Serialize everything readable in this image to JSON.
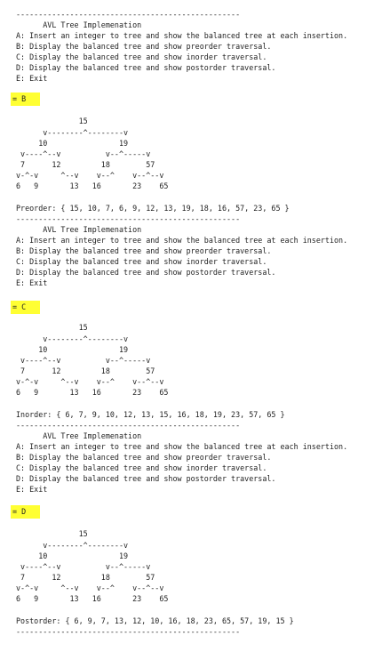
{
  "console": {
    "blocks": [
      {
        "sep_top": "--------------------------------------------------",
        "menu_title": "      AVL Tree Implemenation",
        "menu": [
          "A: Insert an integer to tree and show the balanced tree at each insertion.",
          "B: Display the balanced tree and show preorder traversal.",
          "C: Display the balanced tree and show inorder traversal.",
          "D: Display the balanced tree and show postorder traversal.",
          "E: Exit"
        ],
        "prompt": "= B",
        "tree": [
          "              15",
          "      v--------^--------v",
          "     10                19",
          " v----^--v          v--^-----v",
          " 7      12         18        57",
          "v-^-v     ^--v    v--^    v--^--v",
          "6   9       13   16       23    65"
        ],
        "result": "Preorder: { 15, 10, 7, 6, 9, 12, 13, 19, 18, 16, 57, 23, 65 }"
      },
      {
        "sep_top": "--------------------------------------------------",
        "menu_title": "      AVL Tree Implemenation",
        "menu": [
          "A: Insert an integer to tree and show the balanced tree at each insertion.",
          "B: Display the balanced tree and show preorder traversal.",
          "C: Display the balanced tree and show inorder traversal.",
          "D: Display the balanced tree and show postorder traversal.",
          "E: Exit"
        ],
        "prompt": "= C",
        "tree": [
          "              15",
          "      v--------^--------v",
          "     10                19",
          " v----^--v          v--^-----v",
          " 7      12         18        57",
          "v-^-v     ^--v    v--^    v--^--v",
          "6   9       13   16       23    65"
        ],
        "result": "Inorder: { 6, 7, 9, 10, 12, 13, 15, 16, 18, 19, 23, 57, 65 }"
      },
      {
        "sep_top": "--------------------------------------------------",
        "menu_title": "      AVL Tree Implemenation",
        "menu": [
          "A: Insert an integer to tree and show the balanced tree at each insertion.",
          "B: Display the balanced tree and show preorder traversal.",
          "C: Display the balanced tree and show inorder traversal.",
          "D: Display the balanced tree and show postorder traversal.",
          "E: Exit"
        ],
        "prompt": "= D",
        "tree": [
          "              15",
          "      v--------^--------v",
          "     10                19",
          " v----^--v          v--^-----v",
          " 7      12         18        57",
          "v-^-v     ^--v    v--^    v--^--v",
          "6   9       13   16       23    65"
        ],
        "result": "Postorder: { 6, 9, 7, 13, 12, 10, 16, 18, 23, 65, 57, 19, 15 }"
      }
    ],
    "final_sep": "--------------------------------------------------"
  },
  "colors": {
    "highlight": "#ffff33",
    "text": "#1f1f1f",
    "background": "#ffffff"
  }
}
